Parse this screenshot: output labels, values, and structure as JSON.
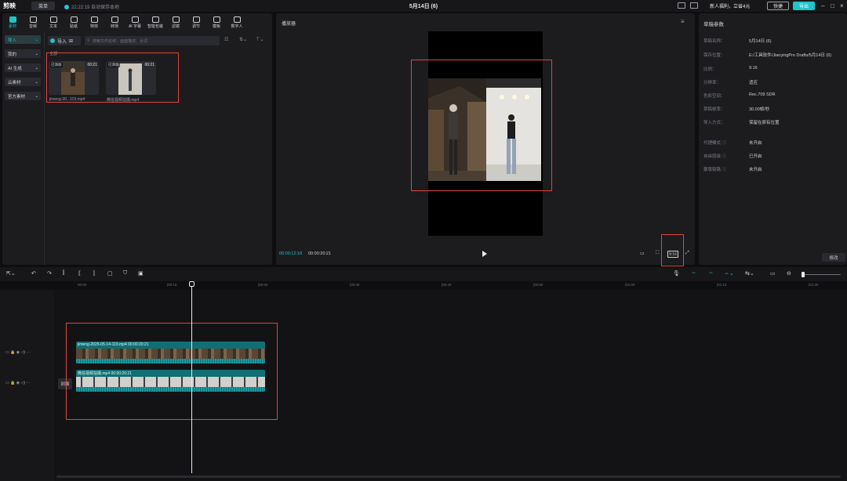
{
  "app": {
    "logo": "剪映",
    "menu": "菜单",
    "autosave": "22:22:19 自动保存本地",
    "project_title": "5月14日 (6)"
  },
  "header": {
    "promo": "新人福利，立省4元",
    "shortcut": "快捷",
    "export": "导出"
  },
  "toolbar": [
    {
      "label": "素材",
      "icon": "media-icon"
    },
    {
      "label": "音频",
      "icon": "audio-icon"
    },
    {
      "label": "文本",
      "icon": "text-icon"
    },
    {
      "label": "贴纸",
      "icon": "sticker-icon"
    },
    {
      "label": "特效",
      "icon": "effects-icon"
    },
    {
      "label": "转场",
      "icon": "transition-icon"
    },
    {
      "label": "AI 字幕",
      "icon": "ai-caption-icon"
    },
    {
      "label": "智能包装",
      "icon": "smart-pack-icon"
    },
    {
      "label": "滤镜",
      "icon": "filter-icon"
    },
    {
      "label": "调节",
      "icon": "adjust-icon"
    },
    {
      "label": "模板",
      "icon": "template-icon"
    },
    {
      "label": "数字人",
      "icon": "avatar-icon"
    }
  ],
  "side_nav": [
    "导入",
    "我的",
    "AI 生成",
    "云素材",
    "官方素材"
  ],
  "media": {
    "import_label": "导入",
    "search_placeholder": "搜索文件名称、画面描述、台词",
    "all_label": "全部",
    "clips": [
      {
        "tag": "已添加",
        "duration": "00:21",
        "name": "jimeng-20...119.mp4"
      },
      {
        "tag": "已添加",
        "duration": "00:21",
        "name": "微信视频拍摄.mp4"
      }
    ]
  },
  "player": {
    "title": "播放器",
    "time_current": "00:00:12:18",
    "time_total": "00:00:20:21",
    "ratio": "9:16"
  },
  "draft": {
    "title": "草稿参数",
    "rows": [
      {
        "k": "草稿名称：",
        "v": "5月14日 (6)"
      },
      {
        "k": "保存位置：",
        "v": "E:/工具软件/JianyingPro Drafts/5月14日 (6)"
      },
      {
        "k": "比例：",
        "v": "9:16"
      },
      {
        "k": "分辨率：",
        "v": "适应"
      },
      {
        "k": "色彩空间：",
        "v": "Rec.709 SDR"
      },
      {
        "k": "草稿帧率：",
        "v": "30.00帧/秒"
      },
      {
        "k": "导入方式：",
        "v": "保留在原有位置"
      },
      {
        "k": "代理模式 ⓘ",
        "v": "未开启"
      },
      {
        "k": "自由层级 ⓘ",
        "v": "已开启"
      },
      {
        "k": "蒙版链路 ⓘ",
        "v": "未开启"
      }
    ],
    "modify": "修改"
  },
  "timeline": {
    "ticks": [
      "00:00",
      "|00:10",
      "|00:20",
      "|00:30",
      "|00:40",
      "|00:50",
      "|01:00",
      "|01:10",
      "|01:20"
    ],
    "cover_label": "封面",
    "tracks": [
      {
        "label": "jimeng-2025-05-14-119.mp4   00:00:20:21"
      },
      {
        "label": "微信视频拍摄.mp4   00:00:20:21"
      }
    ]
  },
  "colors": {
    "accent": "#1fc3c9",
    "highlight": "#e0443a",
    "clip": "#0f6f73"
  }
}
